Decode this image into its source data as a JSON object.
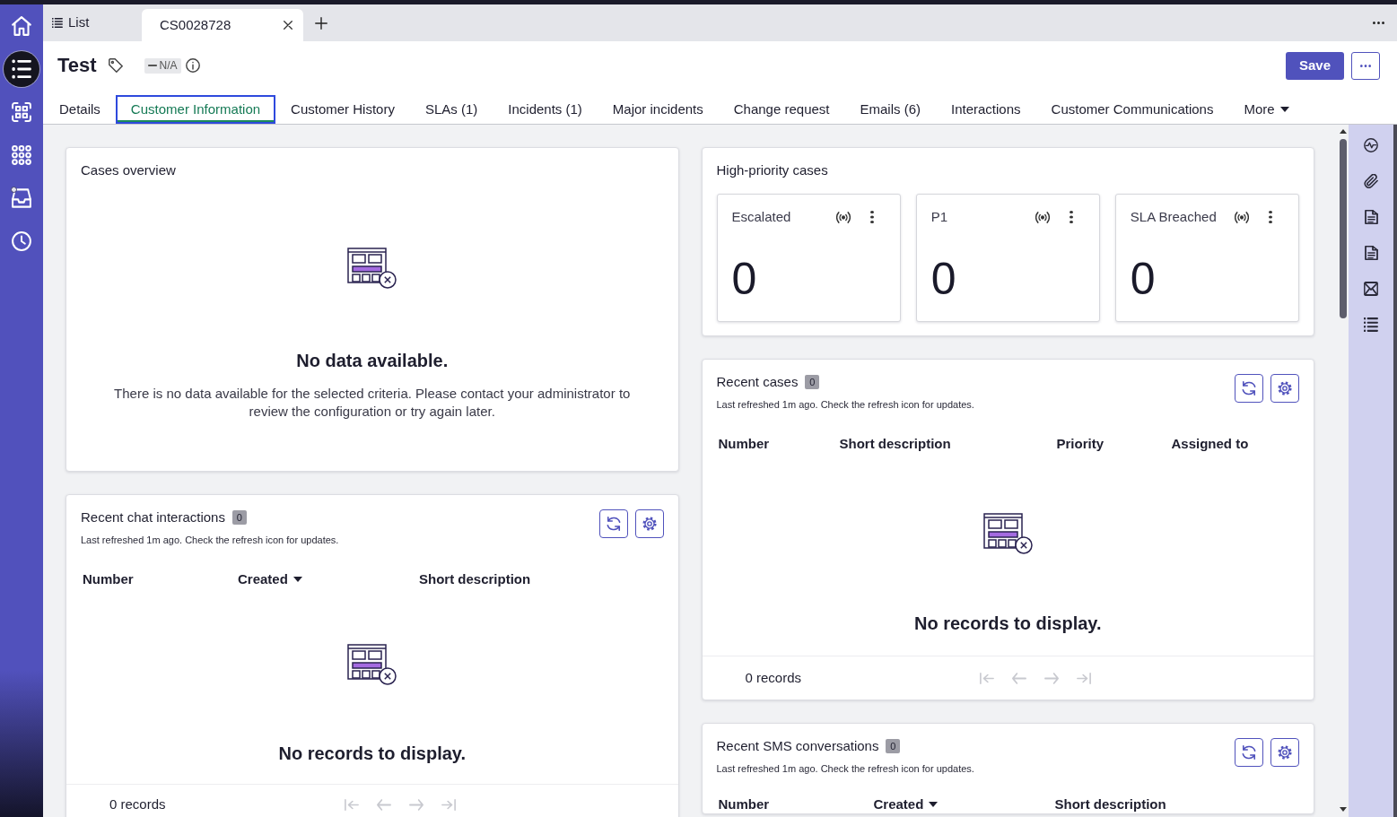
{
  "sidebar": [
    {
      "kind": "home",
      "selected": false,
      "notification": false
    },
    {
      "kind": "list",
      "selected": true,
      "notification": false
    },
    {
      "kind": "scan",
      "selected": false,
      "notification": false
    },
    {
      "kind": "apps",
      "selected": false,
      "notification": false
    },
    {
      "kind": "inbox",
      "selected": false,
      "notification": true
    },
    {
      "kind": "history",
      "selected": false,
      "notification": false
    }
  ],
  "window_tabs": [
    {
      "kind": "list",
      "label": "List",
      "selected": false
    },
    {
      "kind": "record",
      "label": "CS0028728",
      "selected": true
    }
  ],
  "record": {
    "title": "Test",
    "status": "N/A",
    "save": "Save"
  },
  "tabs": [
    {
      "kind": "tab",
      "label": "Details",
      "selected": false
    },
    {
      "kind": "tab",
      "label": "Customer Information",
      "selected": true
    },
    {
      "kind": "tab",
      "label": "Customer History",
      "selected": false
    },
    {
      "kind": "tab",
      "label": "SLAs (1)",
      "selected": false
    },
    {
      "kind": "tab",
      "label": "Incidents (1)",
      "selected": false
    },
    {
      "kind": "tab",
      "label": "Major incidents",
      "selected": false
    },
    {
      "kind": "tab",
      "label": "Change request",
      "selected": false
    },
    {
      "kind": "tab",
      "label": "Emails (6)",
      "selected": false
    },
    {
      "kind": "tab",
      "label": "Interactions",
      "selected": false
    },
    {
      "kind": "tab",
      "label": "Customer Communications",
      "selected": false
    },
    {
      "kind": "menu",
      "label": "More",
      "selected": false
    }
  ],
  "left_column": [
    {
      "kind": "empty_chart",
      "title": "Cases overview",
      "empty_title": "No data available.",
      "empty_text": "There is no data available for the selected criteria. Please contact your administrator to review the configuration or try again later."
    },
    {
      "kind": "list",
      "title": "Recent chat interactions",
      "count": "0",
      "refreshed": "Last refreshed 1m ago. Check the refresh icon for updates.",
      "columns": [
        {
          "label": "Number",
          "sorted": false
        },
        {
          "label": "Created",
          "sorted": true
        },
        {
          "label": "Short description",
          "sorted": false
        }
      ],
      "empty": "No records to display.",
      "footer": "0 records",
      "pager_disabled": true
    }
  ],
  "right_column": [
    {
      "kind": "kpi",
      "title": "High-priority cases",
      "cards": [
        {
          "label": "Escalated",
          "value": "0"
        },
        {
          "label": "P1",
          "value": "0"
        },
        {
          "label": "SLA Breached",
          "value": "0"
        }
      ]
    },
    {
      "kind": "list",
      "title": "Recent cases",
      "count": "0",
      "refreshed": "Last refreshed 1m ago. Check the refresh icon for updates.",
      "columns": [
        {
          "label": "Number",
          "sorted": false
        },
        {
          "label": "Short description",
          "sorted": false
        },
        {
          "label": "Priority",
          "sorted": false
        },
        {
          "label": "Assigned to",
          "sorted": false
        }
      ],
      "empty": "No records to display.",
      "footer": "0 records",
      "pager_disabled": true
    },
    {
      "kind": "list",
      "title": "Recent SMS conversations",
      "count": "0",
      "refreshed": "Last refreshed 1m ago. Check the refresh icon for updates.",
      "columns": [
        {
          "label": "Number",
          "sorted": false
        },
        {
          "label": "Created",
          "sorted": true
        },
        {
          "label": "Short description",
          "sorted": false
        }
      ]
    }
  ],
  "right_rail": [
    {
      "kind": "activity"
    },
    {
      "kind": "attachment"
    },
    {
      "kind": "document"
    },
    {
      "kind": "document"
    },
    {
      "kind": "mail"
    },
    {
      "kind": "list"
    }
  ]
}
